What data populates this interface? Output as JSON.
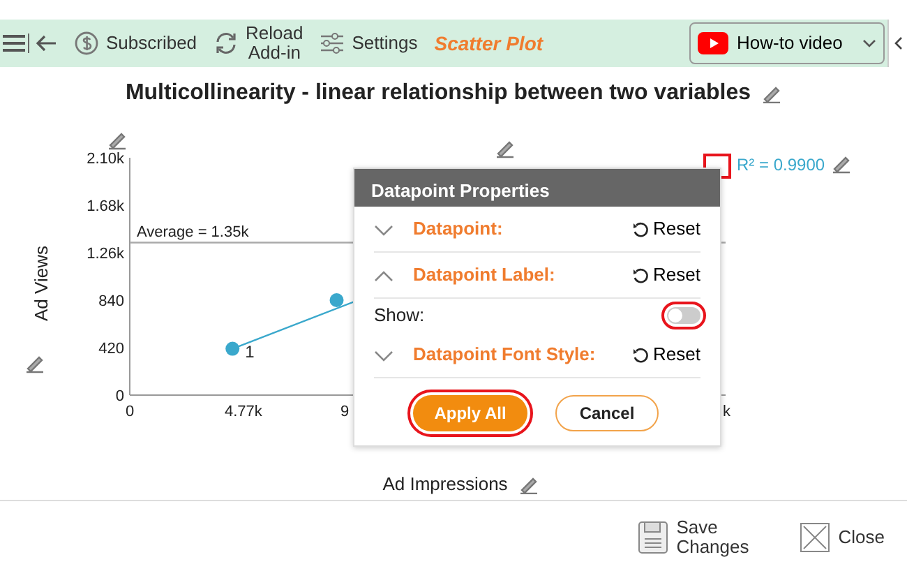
{
  "toolbar": {
    "items": [
      {
        "kind": "subscribed",
        "label": "Subscribed"
      },
      {
        "kind": "reload",
        "label": "Reload\nAdd-in"
      },
      {
        "kind": "settings",
        "label": "Settings"
      }
    ],
    "app_title": "Scatter Plot",
    "video_button": "How-to video"
  },
  "chart_title": "Multicollinearity - linear relationship between two variables",
  "chart": {
    "chart_data": {
      "type": "scatter",
      "xlabel": "Ad Impressions",
      "ylabel": "Ad Views",
      "x": [
        4310,
        8680
      ],
      "series": [
        {
          "color": "#3aa8cc",
          "values": [
            410,
            840
          ]
        }
      ],
      "xlim": [
        0,
        25000
      ],
      "ylim": [
        0,
        2100
      ],
      "yticks": [
        0,
        {
          "value": 420,
          "label": "420"
        },
        {
          "value": 840,
          "label": "840"
        },
        {
          "value": 1260,
          "label": "1.26k"
        },
        {
          "value": 1680,
          "label": "1.68k"
        },
        {
          "value": 2100,
          "label": "2.10k"
        }
      ],
      "xticks": [
        0,
        {
          "value": 4770,
          "label": "4.77k"
        }
      ],
      "ref_lines": [
        {
          "axis": "y",
          "value": 1350,
          "label": "Average = 1.35k"
        }
      ],
      "annotations": [
        "R² = 0.9900",
        {
          "text": "1",
          "x": 4310,
          "y": 410
        }
      ]
    },
    "cut_tick_labels": [
      "9",
      "k"
    ]
  },
  "dialog": {
    "title": "Datapoint Properties",
    "sections": [
      {
        "label": "Datapoint:",
        "expanded": false,
        "reset": "Reset"
      },
      {
        "label": "Datapoint Label:",
        "expanded": true,
        "reset": "Reset",
        "fields": [
          {
            "label": "Show:",
            "on": false
          }
        ]
      },
      {
        "label": "Datapoint Font Style:",
        "expanded": false,
        "reset": "Reset"
      }
    ],
    "apply": "Apply All",
    "cancel": "Cancel"
  },
  "footer": {
    "save": "Save\nChanges",
    "close": "Close"
  }
}
